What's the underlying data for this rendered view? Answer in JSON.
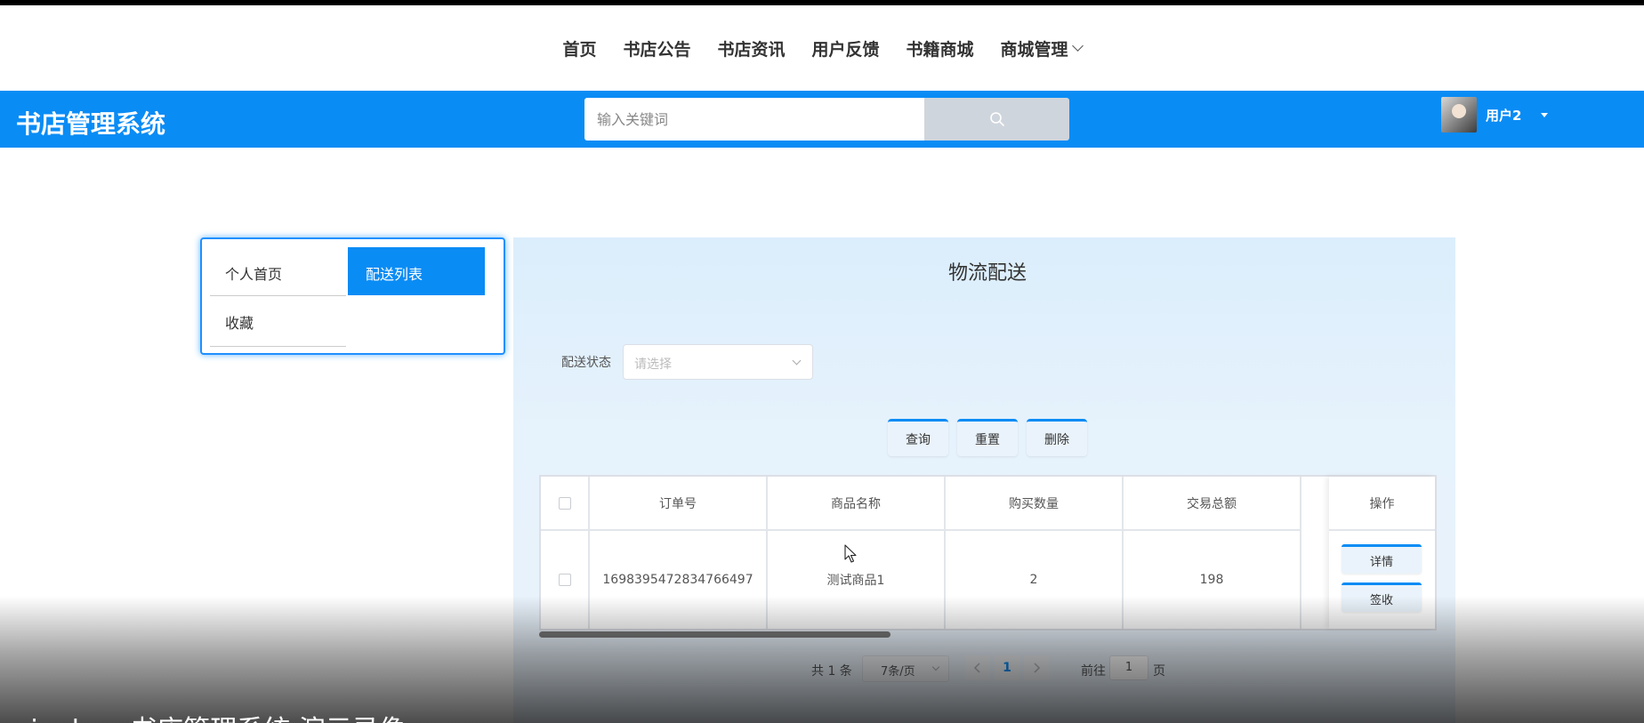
{
  "nav": {
    "items": [
      "首页",
      "书店公告",
      "书店资讯",
      "用户反馈",
      "书籍商城"
    ],
    "dropdown_label": "商城管理"
  },
  "header": {
    "brand": "书店管理系统",
    "search_placeholder": "输入关键词",
    "username": "用户2"
  },
  "sidebar": {
    "items": [
      {
        "label": "个人首页",
        "active": false
      },
      {
        "label": "配送列表",
        "active": true
      },
      {
        "label": "收藏",
        "active": false
      }
    ]
  },
  "main": {
    "title": "物流配送",
    "filter": {
      "label": "配送状态",
      "placeholder": "请选择"
    },
    "buttons": {
      "query": "查询",
      "reset": "重置",
      "delete": "删除"
    },
    "table": {
      "columns": [
        "订单号",
        "商品名称",
        "购买数量",
        "交易总额",
        "操作"
      ],
      "rows": [
        {
          "order_no": "1698395472834766497",
          "product": "测试商品1",
          "quantity": "2",
          "total": "198",
          "actions": [
            "详情",
            "签收"
          ]
        }
      ]
    },
    "pagination": {
      "total": "共 1 条",
      "page_size": "7条/页",
      "current_page": "1",
      "goto_label": "前往",
      "goto_value": "1",
      "page_suffix": "页"
    }
  },
  "caption": "ringbo...书店管理系统 演示录像"
}
